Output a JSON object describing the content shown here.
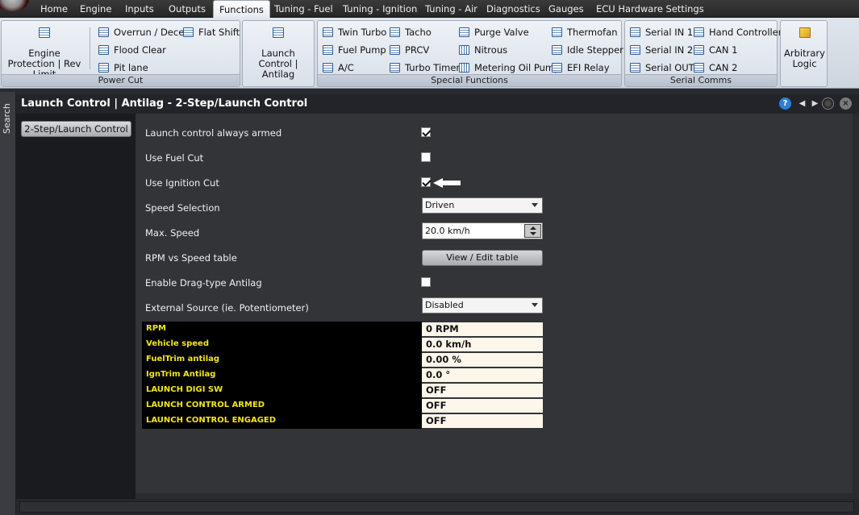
{
  "menubar": {
    "items": [
      "Home",
      "Engine",
      "Inputs",
      "Outputs",
      "Functions",
      "Tuning - Fuel",
      "Tuning - Ignition",
      "Tuning - Air",
      "Diagnostics",
      "Gauges",
      "ECU Hardware Settings"
    ],
    "active": "Functions"
  },
  "ribbon": {
    "power_cut": {
      "caption": "Power Cut",
      "engine_protection": "Engine Protection | Rev Limit",
      "overrun": "Overrun / Decel",
      "flood_clear": "Flood Clear",
      "pit_lane": "Pit lane",
      "flat_shift": "Flat Shift"
    },
    "launch_control": {
      "label": "Launch Control | Antilag"
    },
    "special_functions": {
      "caption": "Special Functions",
      "twin_turbo": "Twin Turbo",
      "fuel_pump": "Fuel Pump",
      "ac": "A/C",
      "tacho": "Tacho",
      "prcv": "PRCV",
      "turbo_timer": "Turbo Timer",
      "purge_valve": "Purge Valve",
      "nitrous": "Nitrous",
      "metering_oil_pump": "Metering Oil Pump",
      "thermofan": "Thermofan",
      "idle_stepper": "Idle Stepper",
      "efi_relay": "EFI Relay"
    },
    "serial_comms": {
      "caption": "Serial Comms",
      "serial_in_1": "Serial IN 1",
      "serial_in_2": "Serial IN 2",
      "serial_out": "Serial OUT",
      "hand_controller": "Hand Controller",
      "can_1": "CAN 1",
      "can_2": "CAN 2"
    },
    "arbitrary_logic": {
      "label": "Arbitrary Logic"
    }
  },
  "side": {
    "search_label": "Search"
  },
  "panel": {
    "title": "Launch Control | Antilag - 2-Step/Launch Control",
    "help": "?",
    "nav_button": "2-Step/Launch Control"
  },
  "settings": {
    "always_armed": {
      "label": "Launch control always armed",
      "checked": true
    },
    "use_fuel_cut": {
      "label": "Use Fuel Cut",
      "checked": false
    },
    "use_ignition_cut": {
      "label": "Use Ignition Cut",
      "checked": true
    },
    "speed_selection": {
      "label": "Speed Selection",
      "value": "Driven"
    },
    "max_speed": {
      "label": "Max. Speed",
      "value": "20.0 km/h"
    },
    "rpm_table": {
      "label": "RPM vs Speed table",
      "button": "View / Edit table"
    },
    "drag_antilag": {
      "label": "Enable Drag-type Antilag",
      "checked": false
    },
    "external_source": {
      "label": "External Source (ie. Potentiometer)",
      "value": "Disabled"
    }
  },
  "live_values": [
    {
      "name": "RPM",
      "value": "0 RPM"
    },
    {
      "name": "Vehicle speed",
      "value": "0.0 km/h"
    },
    {
      "name": "FuelTrim antilag",
      "value": "0.00 %"
    },
    {
      "name": "IgnTrim Antilag",
      "value": "0.0 °"
    },
    {
      "name": "LAUNCH DIGI SW",
      "value": "OFF"
    },
    {
      "name": "LAUNCH CONTROL ARMED",
      "value": "OFF"
    },
    {
      "name": "LAUNCH CONTROL ENGAGED",
      "value": "OFF"
    }
  ],
  "colors": {
    "value_name": "#f3e61a",
    "value_bg": "#fdf6ea",
    "panel_bg": "#333438"
  }
}
